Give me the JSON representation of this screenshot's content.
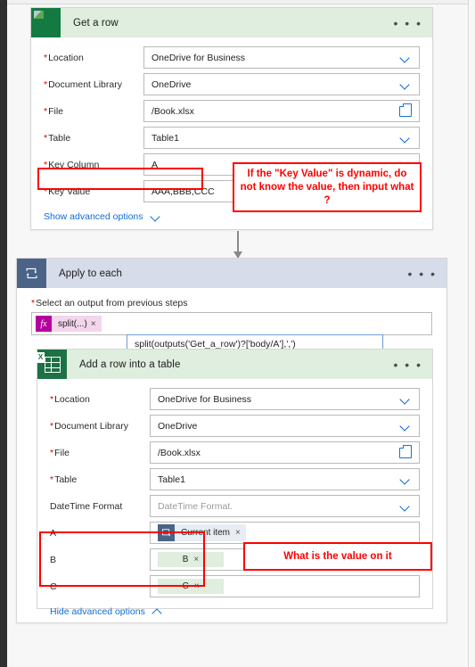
{
  "get_a_row_card": {
    "title": "Get a row",
    "icon": "excel-green-icon",
    "more_label": "• • •",
    "fields": [
      {
        "label": "Location",
        "required": true,
        "value": "OneDrive for Business",
        "control": "dropdown"
      },
      {
        "label": "Document Library",
        "required": true,
        "value": "OneDrive",
        "control": "dropdown"
      },
      {
        "label": "File",
        "required": true,
        "value": "/Book.xlsx",
        "control": "filepicker"
      },
      {
        "label": "Table",
        "required": true,
        "value": "Table1",
        "control": "dropdown"
      },
      {
        "label": "Key Column",
        "required": true,
        "value": "A",
        "control": "dropdown"
      },
      {
        "label": "Key Value",
        "required": true,
        "value": "AAA,BBB,CCC",
        "control": "text"
      }
    ],
    "advanced_link": "Show advanced options"
  },
  "apply_to_each_card": {
    "title": "Apply to each",
    "icon": "loop-icon",
    "more_label": "• • •",
    "output_label": "Select an output from previous steps",
    "output_required": true,
    "output_token": "split(...)",
    "output_token_remove": "×",
    "expression_tooltip": "split(outputs('Get_a_row')?['body/A'],',')"
  },
  "add_row_card": {
    "title": "Add a row into a table",
    "icon": "excel-icon",
    "more_label": "• • •",
    "fields": [
      {
        "label": "Location",
        "required": true,
        "value": "OneDrive for Business",
        "control": "dropdown"
      },
      {
        "label": "Document Library",
        "required": true,
        "value": "OneDrive",
        "control": "dropdown"
      },
      {
        "label": "File",
        "required": true,
        "value": "/Book.xlsx",
        "control": "filepicker"
      },
      {
        "label": "Table",
        "required": true,
        "value": "Table1",
        "control": "dropdown"
      },
      {
        "label": "DateTime Format",
        "required": false,
        "value": "DateTime Format.",
        "control": "dropdown",
        "placeholder": true
      },
      {
        "label": "A",
        "required": false,
        "value": "Current item",
        "control": "token-dynamic"
      },
      {
        "label": "B",
        "required": false,
        "value": "B",
        "control": "token-green"
      },
      {
        "label": "C",
        "required": false,
        "value": "C",
        "control": "token-green"
      }
    ],
    "token_remove": "×",
    "advanced_link": "Hide advanced options"
  },
  "annotations": [
    {
      "id": "key-value-question",
      "text": "If the \"Key Value\" is dynamic, do not know the value, then input what ?"
    },
    {
      "id": "bc-value-question",
      "text": "What is the value on it"
    }
  ],
  "colors": {
    "excel_green": "#137a41",
    "loop_blue": "#4a6387",
    "header_green": "#dfeede",
    "header_blue": "#d6dce9",
    "annotation_red": "#fe0000",
    "link_blue": "#0d6dd4",
    "required_red": "#d40000"
  }
}
